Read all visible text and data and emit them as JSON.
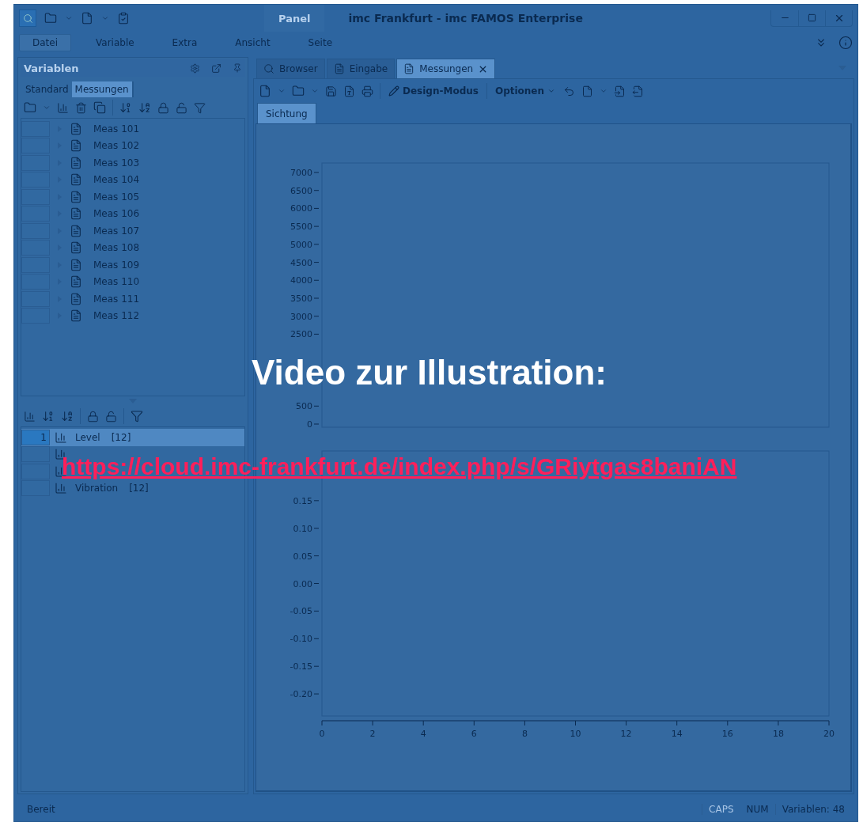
{
  "window": {
    "title": "imc Frankfurt - imc FAMOS Enterprise",
    "contextual_tab": "Panel"
  },
  "ribbon_tabs": [
    {
      "label": "Datei",
      "selected": true
    },
    {
      "label": "Variable",
      "selected": false
    },
    {
      "label": "Extra",
      "selected": false
    },
    {
      "label": "Ansicht",
      "selected": false
    },
    {
      "label": "Seite",
      "selected": false
    }
  ],
  "variables_panel": {
    "title": "Variablen",
    "tabs": [
      {
        "label": "Standard",
        "selected": false
      },
      {
        "label": "Messungen",
        "selected": true
      }
    ],
    "items": [
      {
        "name": "Meas 101"
      },
      {
        "name": "Meas 102"
      },
      {
        "name": "Meas 103"
      },
      {
        "name": "Meas 104"
      },
      {
        "name": "Meas 105"
      },
      {
        "name": "Meas 106"
      },
      {
        "name": "Meas 107"
      },
      {
        "name": "Meas 108"
      },
      {
        "name": "Meas 109"
      },
      {
        "name": "Meas 110"
      },
      {
        "name": "Meas 111"
      },
      {
        "name": "Meas 112"
      }
    ],
    "channels": [
      {
        "index": "1",
        "name": "Level",
        "count": "[12]",
        "selected": true
      },
      {
        "selected": false
      },
      {
        "selected": false
      },
      {
        "name": "Vibration",
        "count": "[12]",
        "selected": false
      }
    ]
  },
  "document_tabs": [
    {
      "label": "Browser",
      "selected": false,
      "closable": false
    },
    {
      "label": "Eingabe",
      "selected": false,
      "closable": false
    },
    {
      "label": "Messungen",
      "selected": true,
      "closable": true
    }
  ],
  "toolbar": {
    "design_mode": "Design-Modus",
    "options": "Optionen"
  },
  "view_tabs": [
    {
      "label": "Sichtung",
      "selected": true
    }
  ],
  "charts": [
    {
      "y_labels_upper": [
        "7000",
        "6500",
        "6000",
        "5500",
        "5000",
        "4500",
        "4000",
        "3500",
        "3000",
        "2500"
      ],
      "y_labels_lower": [
        "500",
        "0"
      ]
    },
    {
      "chart_data": {
        "type": "line",
        "xlim": [
          0,
          20
        ],
        "ylim": [
          -0.24,
          0.24
        ],
        "xticks": [
          0,
          2,
          4,
          6,
          8,
          10,
          12,
          14,
          16,
          18,
          20
        ],
        "yticks": [
          {
            "value": 0.15,
            "label": "0.15"
          },
          {
            "value": 0.1,
            "label": "0.10"
          },
          {
            "value": 0.05,
            "label": "0.05"
          },
          {
            "value": 0,
            "label": "0.00"
          },
          {
            "value": -0.05,
            "label": "-0.05"
          },
          {
            "value": -0.1,
            "label": "-0.10"
          },
          {
            "value": -0.15,
            "label": "-0.15"
          },
          {
            "value": -0.2,
            "label": "-0.20"
          }
        ]
      }
    }
  ],
  "overlay": {
    "heading": "Video zur Illustration:",
    "link": "https://cloud.imc-frankfurt.de/index.php/s/GRiytgas8baniAN"
  },
  "status_bar": {
    "state": "Bereit",
    "indicators": [
      {
        "label": "CAPS",
        "on": false
      },
      {
        "label": "NUM",
        "on": true
      }
    ],
    "variables": "Variablen: 48"
  }
}
